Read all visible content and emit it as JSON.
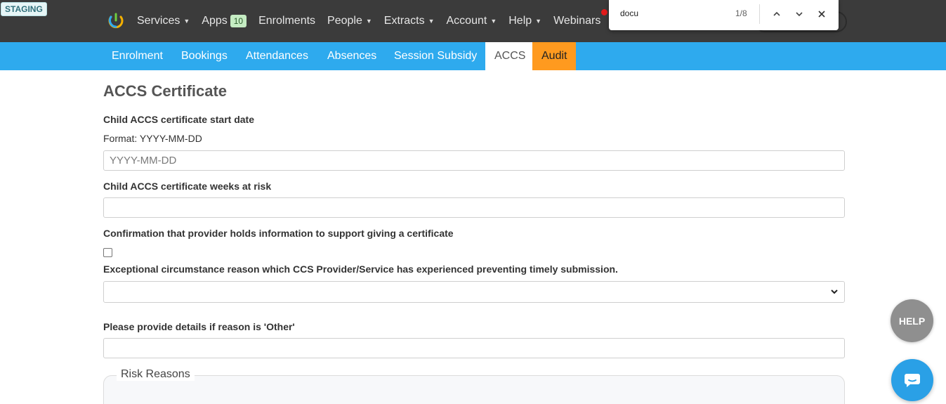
{
  "env_badge": "STAGING",
  "topnav": {
    "items": [
      {
        "label": "Services",
        "caret": true
      },
      {
        "label": "Apps",
        "badge": "10"
      },
      {
        "label": "Enrolments"
      },
      {
        "label": "People",
        "caret": true
      },
      {
        "label": "Extracts",
        "caret": true
      },
      {
        "label": "Account",
        "caret": true
      },
      {
        "label": "Help",
        "caret": true
      },
      {
        "label": "Webinars"
      }
    ]
  },
  "findbar": {
    "query": "docu",
    "count": "1/8"
  },
  "subnav": {
    "tabs": [
      "Enrolment",
      "Bookings",
      "Attendances",
      "Absences",
      "Session Subsidy",
      "ACCS",
      "Audit"
    ],
    "active": "ACCS"
  },
  "form": {
    "title": "ACCS Certificate",
    "start_date_label": "Child ACCS certificate start date",
    "start_date_help": "Format: YYYY-MM-DD",
    "start_date_placeholder": "YYYY-MM-DD",
    "weeks_label": "Child ACCS certificate weeks at risk",
    "confirmation_label": "Confirmation that provider holds information to support giving a certificate",
    "exceptional_label": "Exceptional circumstance reason which CCS Provider/Service has experienced preventing timely submission.",
    "other_label": "Please provide details if reason is 'Other'",
    "risk_reasons_legend": "Risk Reasons"
  },
  "fab": {
    "help": "HELP"
  },
  "colors": {
    "topnav": "#3b3b3b",
    "subnav": "#2eaaee",
    "audit_tab": "#ff9a1f",
    "chat": "#2aa0e6"
  }
}
